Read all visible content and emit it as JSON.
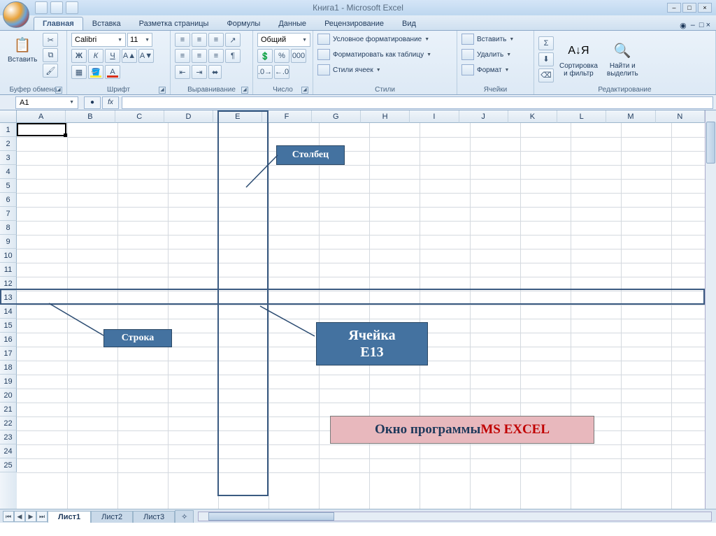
{
  "title": "Книга1 - Microsoft Excel",
  "tabs": [
    "Главная",
    "Вставка",
    "Разметка страницы",
    "Формулы",
    "Данные",
    "Рецензирование",
    "Вид"
  ],
  "activeTab": 0,
  "ribbon": {
    "clipboard": {
      "label": "Буфер обмена",
      "paste": "Вставить"
    },
    "font": {
      "label": "Шрифт",
      "name": "Calibri",
      "size": "11"
    },
    "alignment": {
      "label": "Выравнивание"
    },
    "number": {
      "label": "Число",
      "format": "Общий"
    },
    "styles": {
      "label": "Стили",
      "conditional": "Условное форматирование",
      "formatTable": "Форматировать как таблицу",
      "cellStyles": "Стили ячеек"
    },
    "cells": {
      "label": "Ячейки",
      "insert": "Вставить",
      "delete": "Удалить",
      "format": "Формат"
    },
    "editing": {
      "label": "Редактирование",
      "sort": "Сортировка\nи фильтр",
      "find": "Найти и\nвыделить"
    }
  },
  "nameBox": "A1",
  "columns": [
    "A",
    "B",
    "C",
    "D",
    "E",
    "F",
    "G",
    "H",
    "I",
    "J",
    "K",
    "L",
    "M",
    "N"
  ],
  "rows": [
    "1",
    "2",
    "3",
    "4",
    "5",
    "6",
    "7",
    "8",
    "9",
    "10",
    "11",
    "12",
    "13",
    "14",
    "15",
    "16",
    "17",
    "18",
    "19",
    "20",
    "21",
    "22",
    "23",
    "24",
    "25"
  ],
  "sheets": [
    "Лист1",
    "Лист2",
    "Лист3"
  ],
  "activeSheet": 0,
  "annotations": {
    "column": "Столбец",
    "row": "Строка",
    "cell_l1": "Ячейка",
    "cell_l2": "E13",
    "caption_black": "Окно программы ",
    "caption_red": "MS EXCEL"
  }
}
